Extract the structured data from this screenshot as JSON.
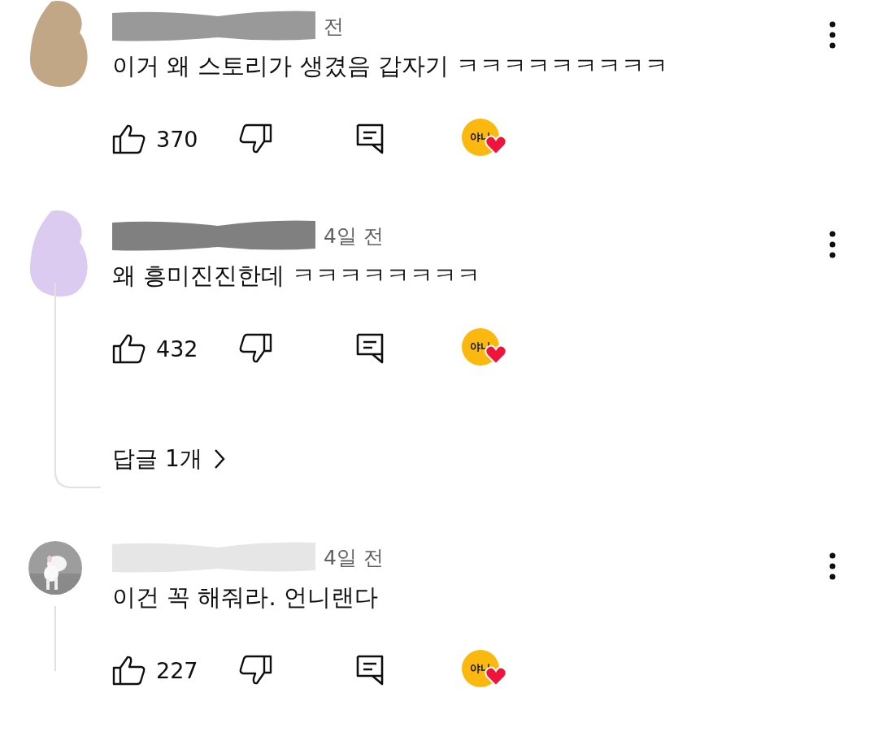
{
  "comments": [
    {
      "avatar": {
        "kind": "blob",
        "color": "#c1a785"
      },
      "name_cover": {
        "color": "#999999"
      },
      "time": "전",
      "text": "이거 왜 스토리가 생겼음 갑자기 ㅋㅋㅋㅋㅋㅋㅋㅋㅋ",
      "likes": "370",
      "creator_heart": {
        "badge": "야나"
      },
      "thread_line": false
    },
    {
      "avatar": {
        "kind": "blob",
        "color": "#dccbf0"
      },
      "name_cover": {
        "color": "#808080"
      },
      "time": "4일 전",
      "text": "왜 흥미진진한데 ㅋㅋㅋㅋㅋㅋㅋㅋ",
      "likes": "432",
      "creator_heart": {
        "badge": "야나"
      },
      "thread_line": true,
      "replies": "답글 1개"
    },
    {
      "name_cover": {
        "color": "#e6e6e6"
      },
      "time": "4일 전",
      "text": "이건 꼭 해줘라. 언니랜다",
      "likes": "227",
      "creator_heart": {
        "badge": "야나"
      },
      "thread_line": true
    }
  ]
}
